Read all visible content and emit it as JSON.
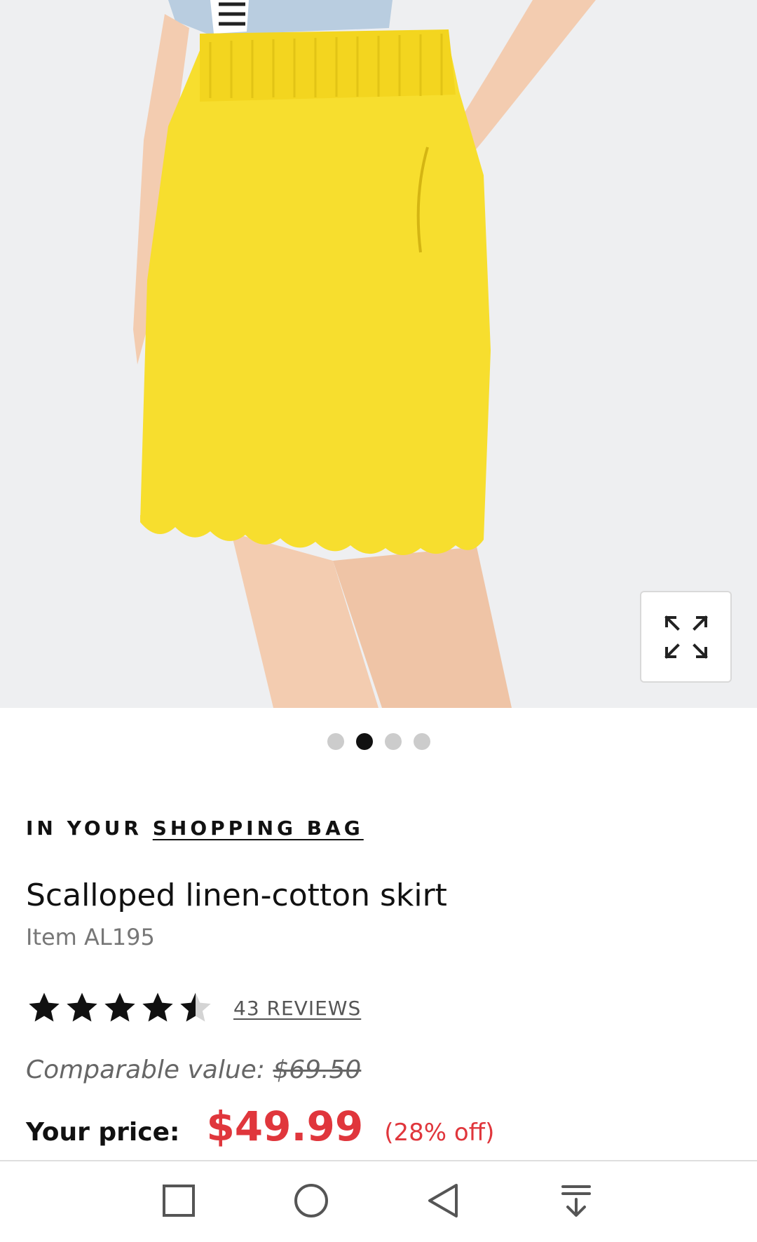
{
  "product_gallery": {
    "image_alt": "Yellow scalloped skirt",
    "colors": {
      "background": "#eeeff1",
      "skirt": "#f7de2e",
      "skin": "#f3ccb0",
      "denim": "#b9cde0"
    },
    "expand_icon": "expand-arrows-icon",
    "carousel": {
      "count": 4,
      "active_index": 1
    }
  },
  "bag_status": {
    "prefix": "IN YOUR",
    "link_label": "SHOPPING BAG"
  },
  "product": {
    "title": "Scalloped linen-cotton skirt",
    "item_number": "Item AL195",
    "rating": 4.5,
    "rating_max": 5,
    "reviews_label": "43 REVIEWS",
    "comparable_label": "Comparable value:",
    "comparable_price": "$69.50",
    "price_label": "Your price:",
    "price": "$49.99",
    "discount": "(28% off)"
  },
  "colors": {
    "accent_price": "#e0363c",
    "text_primary": "#111111",
    "text_secondary": "#777777"
  },
  "system_nav": {
    "buttons": [
      "recents-square-icon",
      "home-circle-icon",
      "back-triangle-icon",
      "notification-pull-down-icon"
    ]
  }
}
